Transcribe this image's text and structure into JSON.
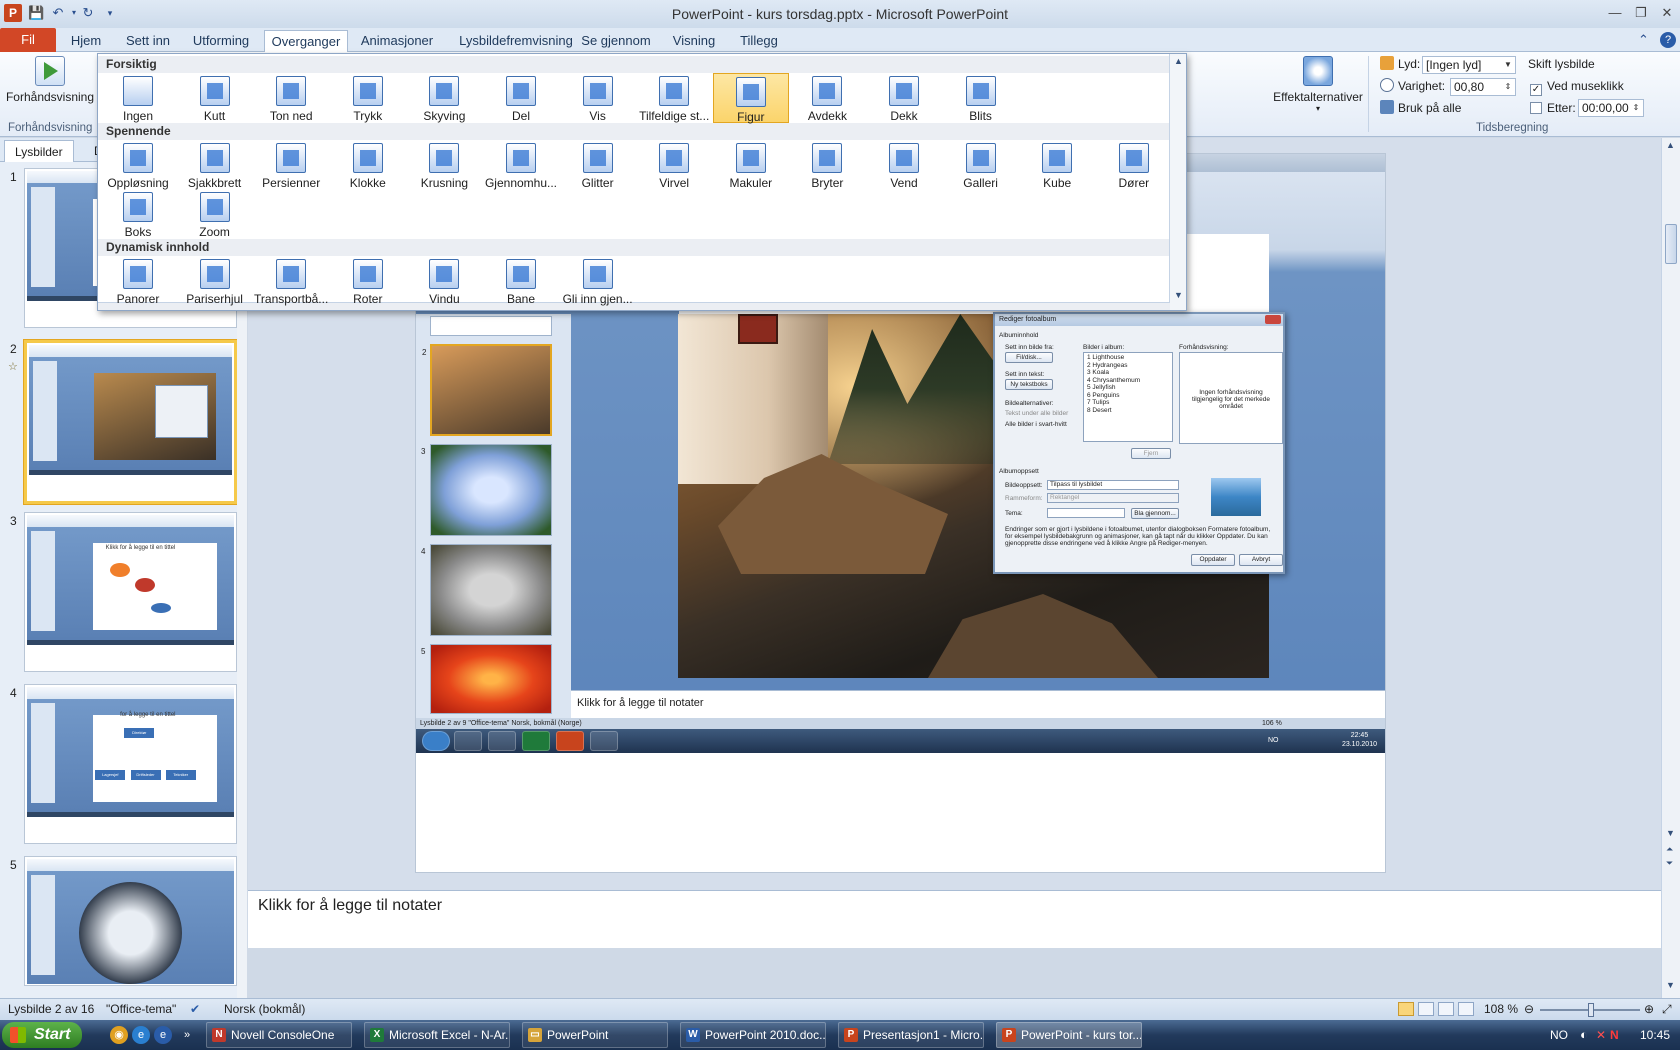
{
  "window": {
    "title": "PowerPoint - kurs torsdag.pptx - Microsoft PowerPoint",
    "app_icon": "P"
  },
  "ribbon_tabs": {
    "file": "Fil",
    "home": "Hjem",
    "insert": "Sett inn",
    "design": "Utforming",
    "transitions": "Overganger",
    "animations": "Animasjoner",
    "slideshow": "Lysbildefremvisning",
    "review": "Se gjennom",
    "view": "Visning",
    "addins": "Tillegg"
  },
  "ribbon": {
    "preview_label": "Forhåndsvisning",
    "preview_group": "Forhåndsvisning",
    "effect_options": "Effektalternativer",
    "sound_label": "Lyd:",
    "sound_value": "[Ingen lyd]",
    "duration_label": "Varighet:",
    "duration_value": "00,80",
    "apply_all": "Bruk på alle",
    "advance_header": "Skift lysbilde",
    "on_click": "Ved museklikk",
    "after_label": "Etter:",
    "after_value": "00:00,00",
    "timing_group": "Tidsberegning"
  },
  "gallery": {
    "sections": {
      "subtle": "Forsiktig",
      "exciting": "Spennende",
      "dynamic": "Dynamisk innhold"
    },
    "subtle_items": [
      "Ingen",
      "Kutt",
      "Ton ned",
      "Trykk",
      "Skyving",
      "Del",
      "Vis",
      "Tilfeldige st...",
      "Figur",
      "Avdekk",
      "Dekk",
      "Blits"
    ],
    "exciting_items": [
      "Oppløsning",
      "Sjakkbrett",
      "Persienner",
      "Klokke",
      "Krusning",
      "Gjennomhu...",
      "Glitter",
      "Virvel",
      "Makuler",
      "Bryter",
      "Vend",
      "Galleri",
      "Kube",
      "Dører",
      "Boks",
      "Zoom"
    ],
    "dynamic_items": [
      "Panorer",
      "Pariserhjul",
      "Transportbå...",
      "Roter",
      "Vindu",
      "Bane",
      "Gli inn gjen..."
    ],
    "selected": "Figur"
  },
  "left_pane": {
    "tab_slides": "Lysbilder",
    "tab_outline": "D",
    "slide_numbers": [
      "1",
      "2",
      "3",
      "4",
      "5"
    ],
    "thumb3_title": "Klikk for å legge til en tittel",
    "thumb4_title": "for å legge til en tittel",
    "thumb4_boxes": [
      "Direktør",
      "Lagersjef",
      "Driftsleder",
      "Tekniker"
    ]
  },
  "inner_screenshot": {
    "notes": "Klikk for å legge til notater",
    "status": "Lysbilde 2 av 9    \"Office-tema\"    Norsk, bokmål (Norge)",
    "zoom": "106 %",
    "lang": "NO",
    "clock_time": "22:45",
    "clock_date": "23.10.2010",
    "thumb_numbers": [
      "2",
      "3",
      "4",
      "5"
    ]
  },
  "dialog": {
    "title": "Rediger fotoalbum",
    "album_content": "Albuminnhold",
    "insert_from": "Sett inn bilde fra:",
    "file_disk": "Fil/disk...",
    "insert_text": "Sett inn tekst:",
    "new_textbox": "Ny tekstboks",
    "picture_options": "Bildealternativer:",
    "caption_option": "Tekst under alle bilder",
    "bw_option": "Alle bilder i svart-hvitt",
    "pictures_in_album": "Bilder i album:",
    "pictures": [
      "1   Lighthouse",
      "2   Hydrangeas",
      "3   Koala",
      "4   Chrysanthemum",
      "5   Jellyfish",
      "6   Penguins",
      "7   Tulips",
      "8   Desert"
    ],
    "preview_label": "Forhåndsvisning:",
    "preview_text": "Ingen forhåndsvisning tilgjengelig for det merkede området",
    "remove": "Fjern",
    "album_layout": "Albumoppsett",
    "picture_layout_label": "Bildeoppsett:",
    "picture_layout_value": "Tilpass til lysbildet",
    "frame_shape_label": "Rammeform:",
    "frame_shape_value": "Rektangel",
    "theme_label": "Tema:",
    "browse": "Bla gjennom...",
    "note": "Endringer som er gjort i lysbildene i fotoalbumet, utenfor dialogboksen Formatere fotoalbum, for eksempel lysbildebakgrunn og animasjoner, kan gå tapt når du klikker Oppdater. Du kan gjenopprette disse endringene ved å klikke Angre på Rediger-menyen.",
    "update": "Oppdater",
    "cancel": "Avbryt"
  },
  "notes": {
    "placeholder": "Klikk for å legge til notater"
  },
  "statusbar": {
    "slide_info": "Lysbilde 2 av 16",
    "theme": "\"Office-tema\"",
    "language": "Norsk (bokmål)",
    "zoom": "108 %",
    "zoom_value": 108
  },
  "taskbar": {
    "start": "Start",
    "buttons": [
      {
        "label": "Novell ConsoleOne",
        "icon": "N",
        "color": "#c0392b"
      },
      {
        "label": "Microsoft Excel - N-Ar...",
        "icon": "X",
        "color": "#1f7a3a"
      },
      {
        "label": "PowerPoint",
        "icon": "▭",
        "color": "#d6a43a"
      },
      {
        "label": "PowerPoint 2010.doc...",
        "icon": "W",
        "color": "#2a5ca8"
      },
      {
        "label": "Presentasjon1 - Micro...",
        "icon": "P",
        "color": "#c8441d"
      },
      {
        "label": "PowerPoint - kurs tor...",
        "icon": "P",
        "color": "#c8441d"
      }
    ],
    "lang": "NO",
    "time": "10:45"
  },
  "colors": {
    "file_tab": "#d24726",
    "accent": "#2a5ca8",
    "selection": "#fbd46b"
  }
}
